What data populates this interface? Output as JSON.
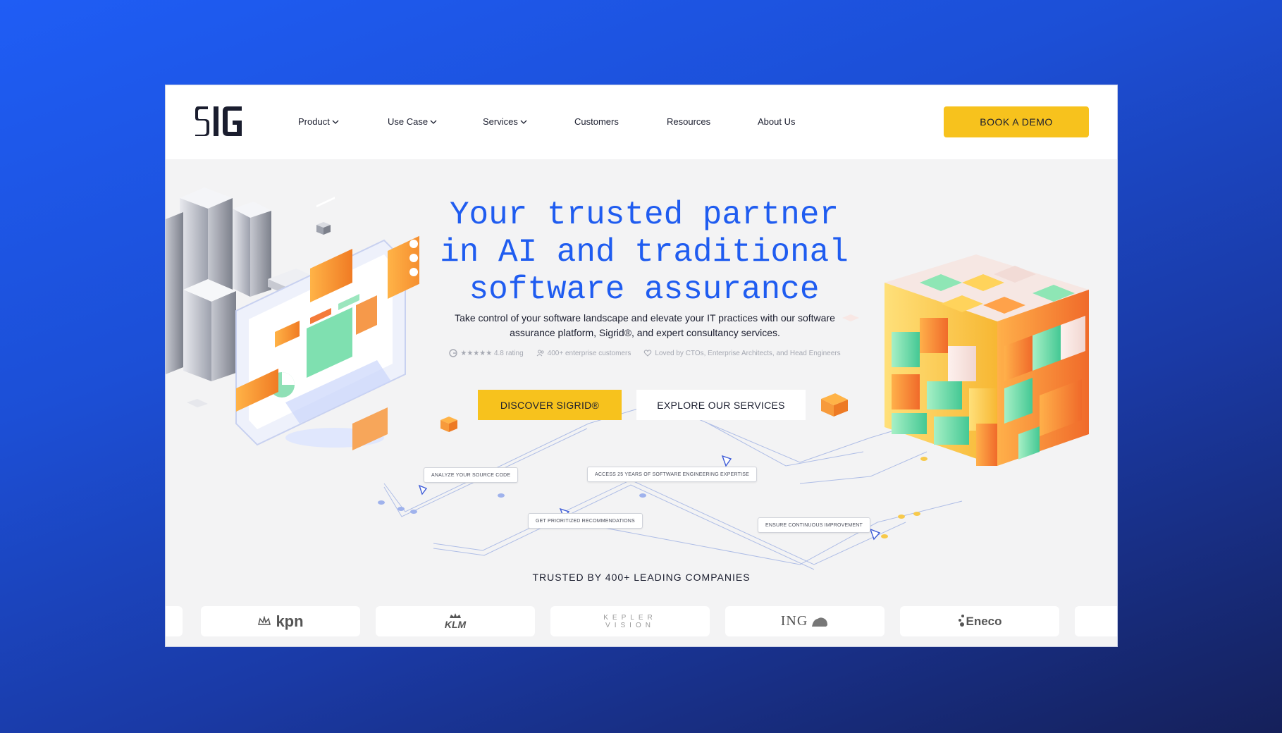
{
  "brand": {
    "logo_text": "SIG"
  },
  "nav": {
    "items": [
      {
        "label": "Product",
        "dropdown": true
      },
      {
        "label": "Use Case",
        "dropdown": true
      },
      {
        "label": "Services",
        "dropdown": true
      },
      {
        "label": "Customers",
        "dropdown": false
      },
      {
        "label": "Resources",
        "dropdown": false
      },
      {
        "label": "About Us",
        "dropdown": false
      }
    ],
    "cta": "BOOK A DEMO"
  },
  "hero": {
    "title": "Your trusted partner\nin AI and traditional\nsoftware assurance",
    "subtitle": "Take control of your software landscape and elevate your IT practices with our software assurance platform, Sigrid®, and expert consultancy services.",
    "rating": "★★★★★ 4.8 rating",
    "customers": "400+ enterprise customers",
    "loved_by": "Loved by CTOs, Enterprise Architects, and Head Engineers",
    "primary_button": "DISCOVER SIGRID®",
    "secondary_button": "EXPLORE OUR SERVICES"
  },
  "steps": [
    "ANALYZE YOUR SOURCE CODE",
    "ACCESS 25 YEARS OF SOFTWARE ENGINEERING EXPERTISE",
    "GET PRIORITIZED RECOMMENDATIONS",
    "ENSURE CONTINUOUS IMPROVEMENT"
  ],
  "trusted": {
    "heading": "TRUSTED BY 400+ LEADING COMPANIES",
    "logos": [
      "kpn",
      "KLM",
      "KEPLER VISION",
      "ING",
      "Eneco"
    ]
  },
  "colors": {
    "accent_blue": "#1f5cf0",
    "cta_yellow": "#f7c21d",
    "text_dark": "#1a1d2e",
    "page_bg": "#f3f3f4"
  },
  "icons": [
    "chevron-down-icon",
    "g2-icon",
    "users-icon",
    "heart-icon",
    "cursor-arrow-icon"
  ]
}
